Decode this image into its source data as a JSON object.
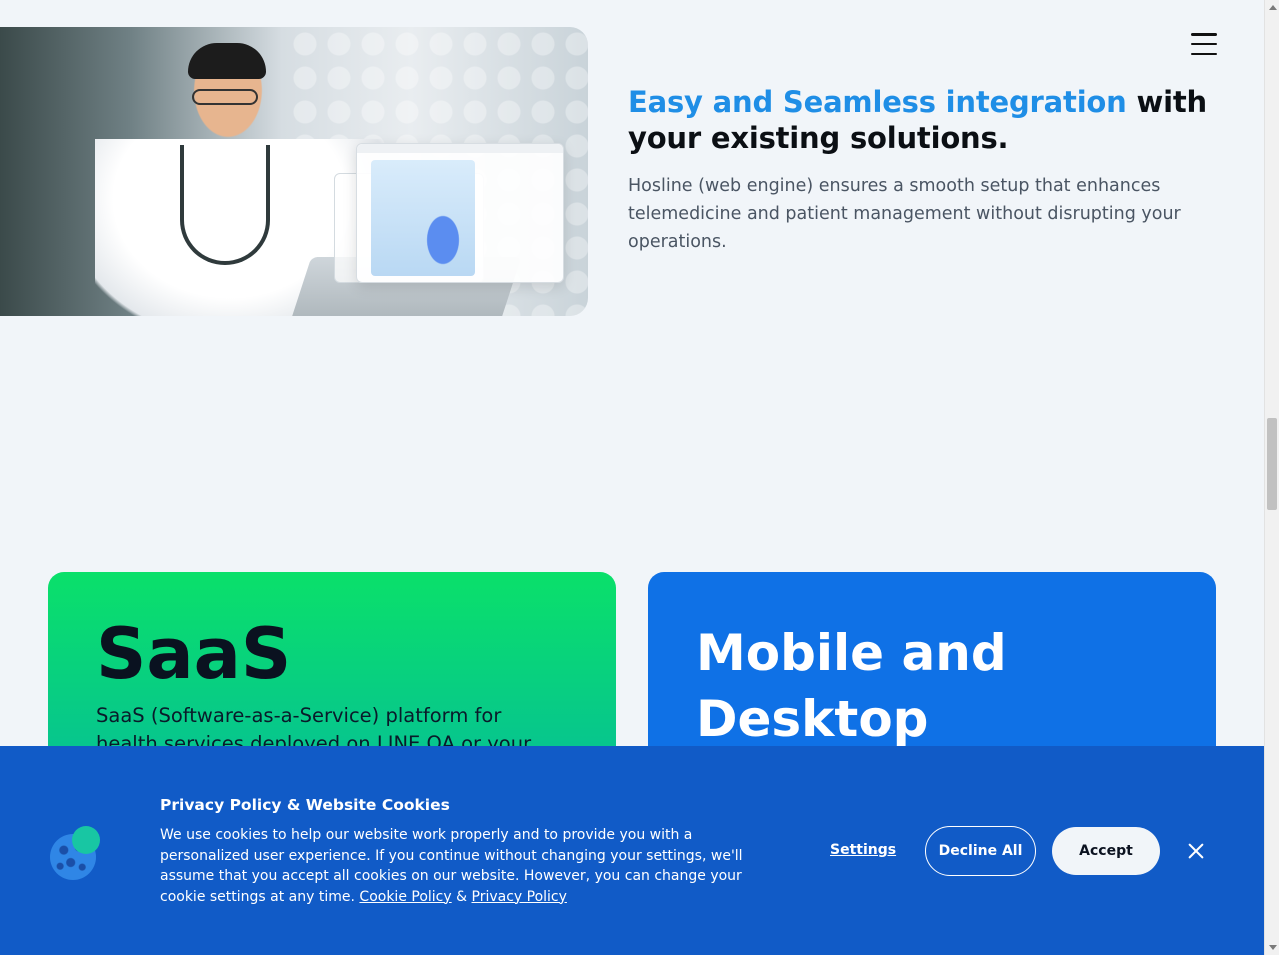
{
  "hero": {
    "image_alt": "Doctor using laptop with Hosline interface",
    "heading_accent": "Easy and Seamless integration",
    "heading_rest": " with your existing solutions.",
    "description": "Hosline (web engine) ensures a smooth setup that enhances telemedicine and patient management without disrupting your operations."
  },
  "menu": {
    "icon": "hamburger-menu-icon"
  },
  "cards": {
    "saas": {
      "title": "SaaS",
      "description": "SaaS (Software-as-a-Service) platform for health services deployed on LINE OA or your"
    },
    "mobile": {
      "title": "Mobile and Desktop"
    }
  },
  "cookie_banner": {
    "icon": "cookie-icon",
    "title": "Privacy Policy & Website Cookies",
    "text": "We use cookies to help our website work properly and to provide you with a personalized user experience. If you continue without changing your settings, we'll assume that you accept all cookies on our website. However, you can change your cookie settings at any time.",
    "cookie_policy_link": "Cookie Policy",
    "link_separator": "&",
    "privacy_policy_link": "Privacy Policy",
    "settings_label": "Settings",
    "decline_label": "Decline All",
    "accept_label": "Accept",
    "close_icon": "close-icon"
  },
  "colors": {
    "accent_blue": "#1f8ee6",
    "banner_blue": "#115bc7",
    "mobile_card_blue": "#0f71e6",
    "saas_green": "#0ae06a",
    "page_bg": "#f1f5f9"
  }
}
